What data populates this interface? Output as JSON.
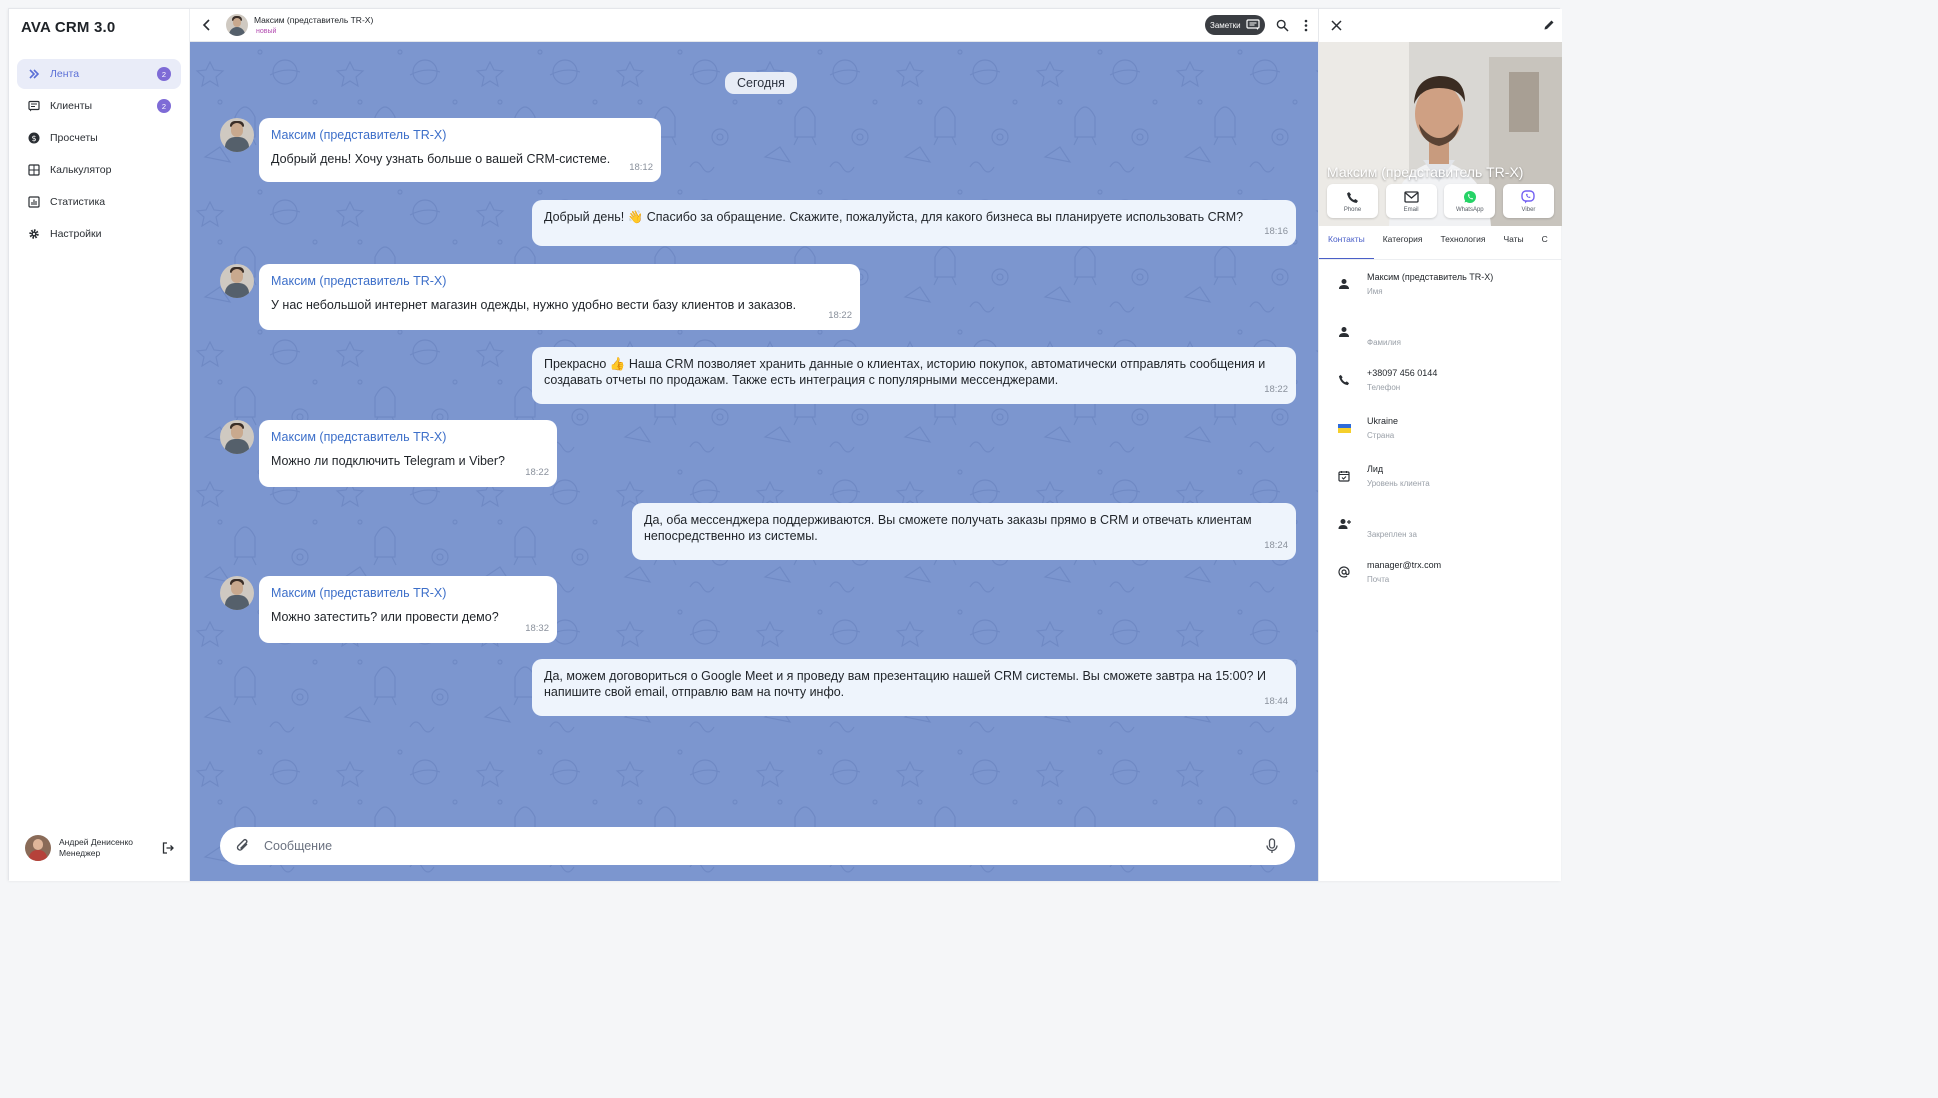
{
  "app": {
    "title": "AVA CRM 3.0"
  },
  "sidebar": {
    "items": [
      {
        "label": "Лента",
        "badge": "2",
        "icon": "double-chevron-icon",
        "active": true
      },
      {
        "label": "Клиенты",
        "badge": "2",
        "icon": "chat-list-icon",
        "active": false
      },
      {
        "label": "Просчеты",
        "badge": "",
        "icon": "dollar-icon",
        "active": false
      },
      {
        "label": "Калькулятор",
        "badge": "",
        "icon": "calculator-icon",
        "active": false
      },
      {
        "label": "Статистика",
        "badge": "",
        "icon": "chart-icon",
        "active": false
      },
      {
        "label": "Настройки",
        "badge": "",
        "icon": "gear-icon",
        "active": false
      }
    ],
    "user": {
      "name": "Андрей Денисенко",
      "role": "Менеджер"
    }
  },
  "chat": {
    "header": {
      "name": "Максим (представитель TR-X)",
      "status": "новый",
      "notes_label": "Заметки"
    },
    "date_label": "Сегодня",
    "messages": [
      {
        "direction": "in",
        "sender": "Максим (представитель TR-X)",
        "text": "Добрый день! Хочу узнать больше о вашей CRM-системе.",
        "time": "18:12"
      },
      {
        "direction": "out",
        "sender": "",
        "text": "Добрый день! 👋 Спасибо за обращение. Скажите, пожалуйста, для какого бизнеса вы планируете использовать CRM?",
        "time": "18:16"
      },
      {
        "direction": "in",
        "sender": "Максим (представитель TR-X)",
        "text": "У нас небольшой интернет магазин одежды, нужно удобно вести базу клиентов и заказов.",
        "time": "18:22"
      },
      {
        "direction": "out",
        "sender": "",
        "text": "Прекрасно 👍 Наша CRM позволяет хранить данные о клиентах, историю покупок, автоматически отправлять сообщения и создавать отчеты по продажам. Также есть интеграция с популярными мессенджерами.",
        "time": "18:22"
      },
      {
        "direction": "in",
        "sender": "Максим (представитель TR-X)",
        "text": "Можно ли подключить Telegram и Viber?",
        "time": "18:22"
      },
      {
        "direction": "out",
        "sender": "",
        "text": "Да, оба мессенджера поддерживаются. Вы сможете получать заказы прямо в CRM и отвечать клиентам непосредственно из системы.",
        "time": "18:24"
      },
      {
        "direction": "in",
        "sender": "Максим (представитель TR-X)",
        "text": "Можно затестить? или провести демо?",
        "time": "18:32"
      },
      {
        "direction": "out",
        "sender": "",
        "text": "Да, можем договориться о Google Meet и я проведу вам презентацию нашей CRM системы. Вы сможете завтра на 15:00? И напишите свой email, отправлю вам на почту инфо.",
        "time": "18:44"
      }
    ],
    "composer": {
      "placeholder": "Сообщение",
      "value": ""
    }
  },
  "panel": {
    "name": "Максим (представитель TR-X)",
    "actions": [
      {
        "label": "Phone",
        "icon": "phone-icon"
      },
      {
        "label": "Email",
        "icon": "email-icon"
      },
      {
        "label": "WhatsApp",
        "icon": "whatsapp-icon",
        "color": "#25d366"
      },
      {
        "label": "Viber",
        "icon": "viber-icon",
        "color": "#7360f2"
      }
    ],
    "tabs": [
      "Контакты",
      "Категория",
      "Технология",
      "Чаты",
      "С"
    ],
    "active_tab": "Контакты",
    "fields": [
      {
        "icon": "person-icon",
        "value": "Максим (представитель TR-X)",
        "label": "Имя"
      },
      {
        "icon": "person-icon",
        "value": "",
        "label": "Фамилия"
      },
      {
        "icon": "phone-icon",
        "value": "+38097 456 0144",
        "label": "Телефон"
      },
      {
        "icon": "ukraine-flag-icon",
        "value": "Ukraine",
        "label": "Страна"
      },
      {
        "icon": "calendar-check-icon",
        "value": "Лид",
        "label": "Уровень клиента"
      },
      {
        "icon": "person-add-icon",
        "value": "",
        "label": "Закреплен за"
      },
      {
        "icon": "at-icon",
        "value": "manager@trx.com",
        "label": "Почта"
      }
    ]
  },
  "colors": {
    "accent": "#5b6fd6",
    "badge": "#7e6bd6",
    "chat_bg": "#7c96cf",
    "sender": "#3d6fc9",
    "status": "#b34ab0",
    "outgoing_bubble": "#eef4fc"
  }
}
